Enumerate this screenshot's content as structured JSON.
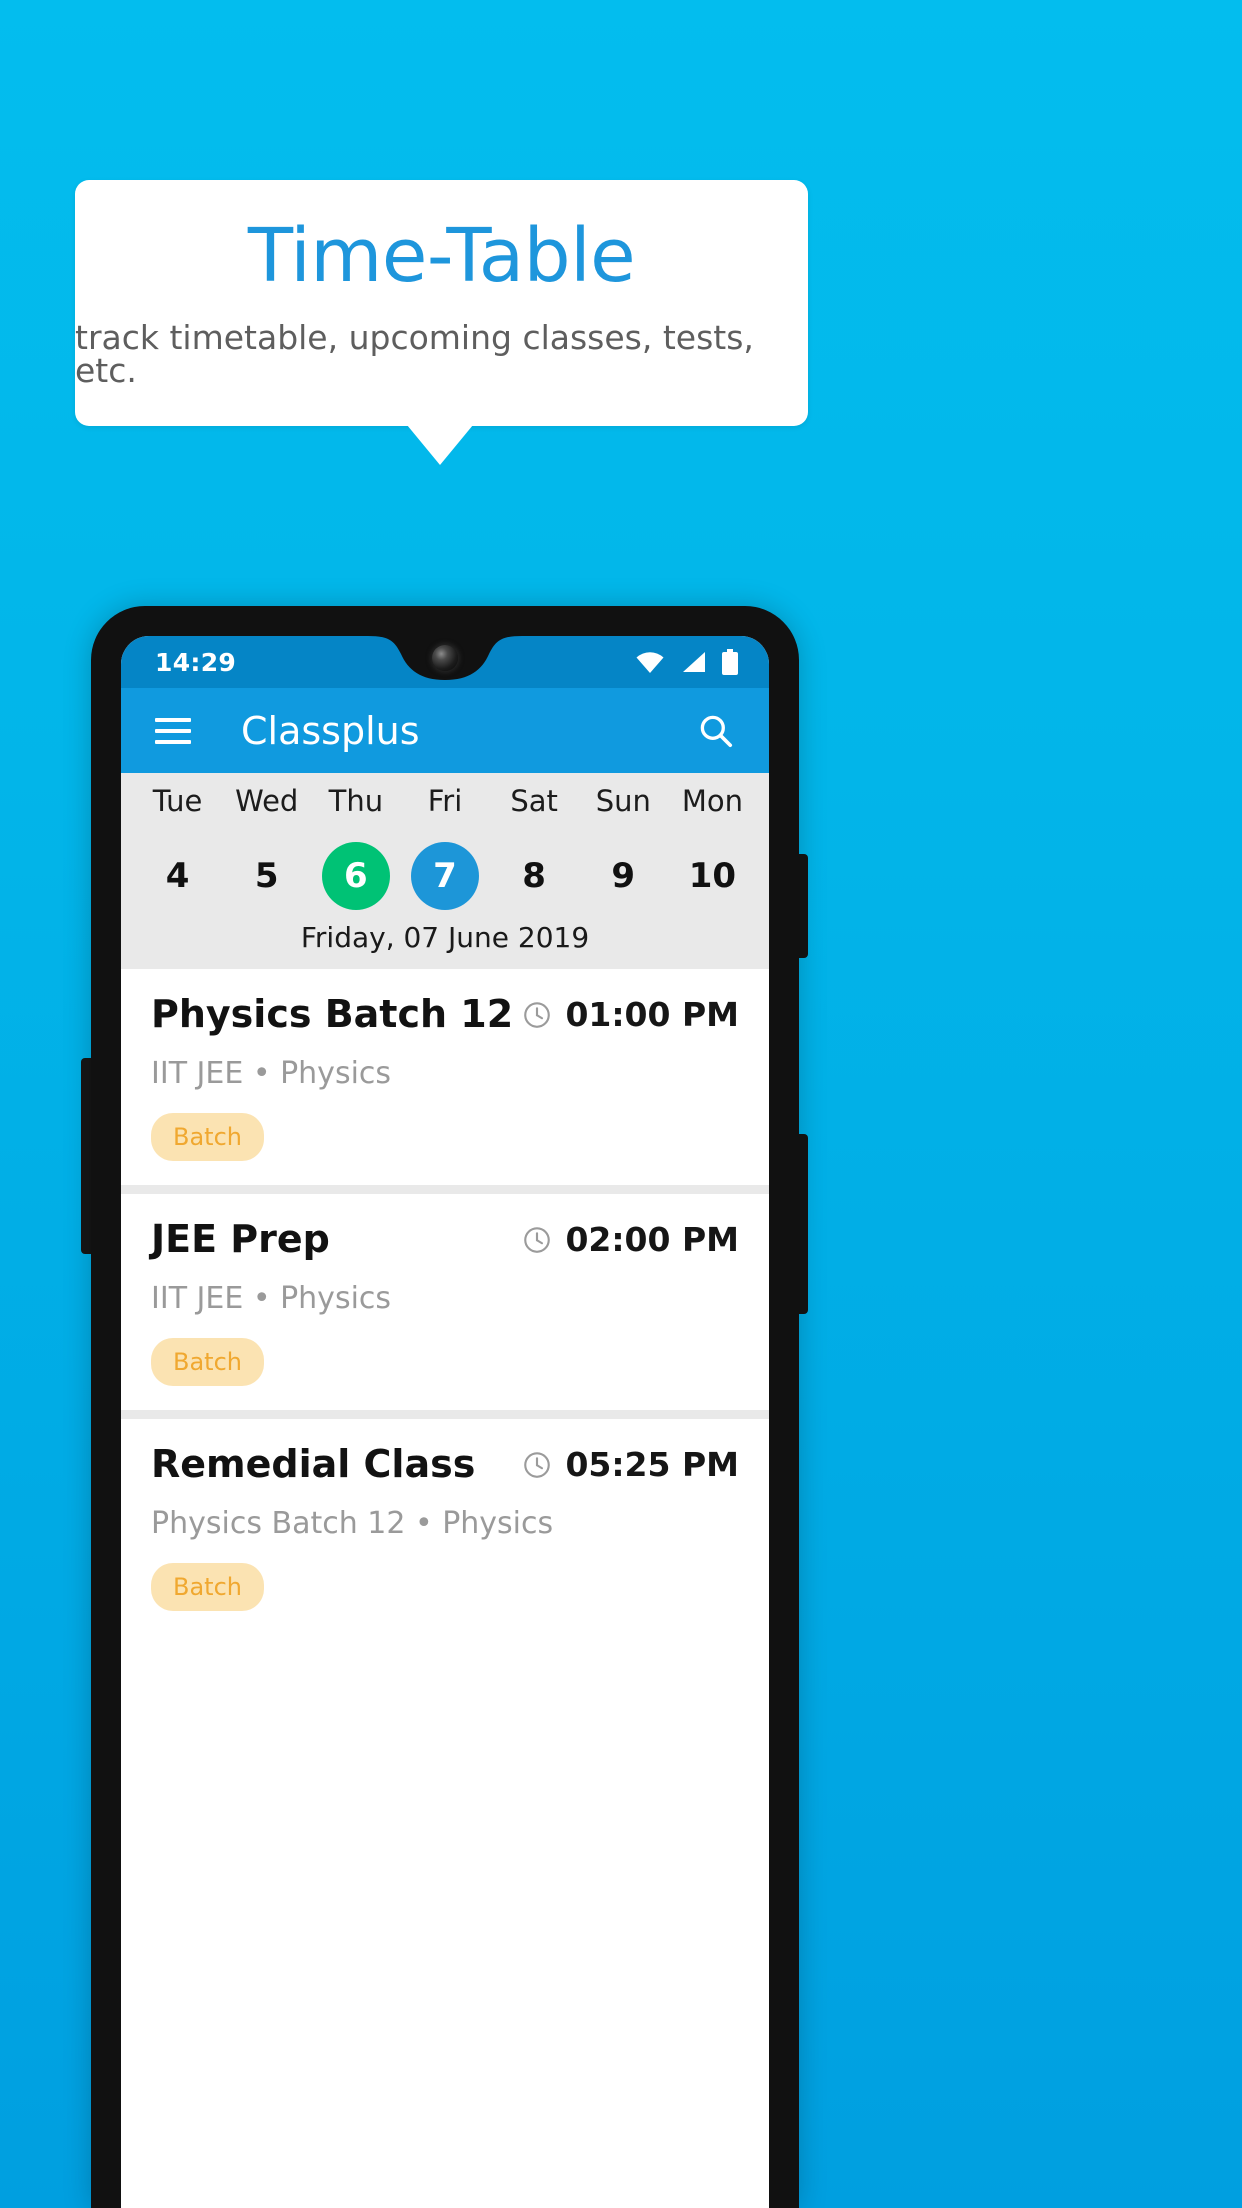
{
  "promo": {
    "title": "Time-Table",
    "subtitle": "track timetable, upcoming classes, tests, etc.",
    "title_color": "#1E96DC",
    "subtitle_color": "#5E5E5E",
    "background_color": "#00BCEC"
  },
  "phone": {
    "status_bar": {
      "time": "14:29",
      "icons": [
        "wifi-icon",
        "signal-icon",
        "battery-icon"
      ],
      "background_color": "#0585C6"
    },
    "app_bar": {
      "menu_icon": "hamburger-menu-icon",
      "title": "Classplus",
      "search_icon": "search-icon",
      "background_color": "#109ADF"
    },
    "day_strip": {
      "background_color": "#E9E9E9",
      "days": [
        {
          "name": "Tue",
          "num": "4",
          "state": "normal"
        },
        {
          "name": "Wed",
          "num": "5",
          "state": "normal"
        },
        {
          "name": "Thu",
          "num": "6",
          "state": "today"
        },
        {
          "name": "Fri",
          "num": "7",
          "state": "selected"
        },
        {
          "name": "Sat",
          "num": "8",
          "state": "normal"
        },
        {
          "name": "Sun",
          "num": "9",
          "state": "normal"
        },
        {
          "name": "Mon",
          "num": "10",
          "state": "normal"
        }
      ],
      "today_color": "#00C275",
      "selected_color": "#1D96D8",
      "date_label": "Friday, 07 June 2019"
    },
    "classes": [
      {
        "title": "Physics Batch 12",
        "time": "01:00 PM",
        "subtitle": "IIT JEE • Physics",
        "chip": "Batch",
        "clock_icon": "clock-icon"
      },
      {
        "title": "JEE Prep",
        "time": "02:00 PM",
        "subtitle": "IIT JEE • Physics",
        "chip": "Batch",
        "clock_icon": "clock-icon"
      },
      {
        "title": "Remedial Class",
        "time": "05:25 PM",
        "subtitle": "Physics Batch 12 • Physics",
        "chip": "Batch",
        "clock_icon": "clock-icon"
      }
    ],
    "chip_bg_color": "#FBE3B2",
    "chip_text_color": "#F0A830"
  }
}
